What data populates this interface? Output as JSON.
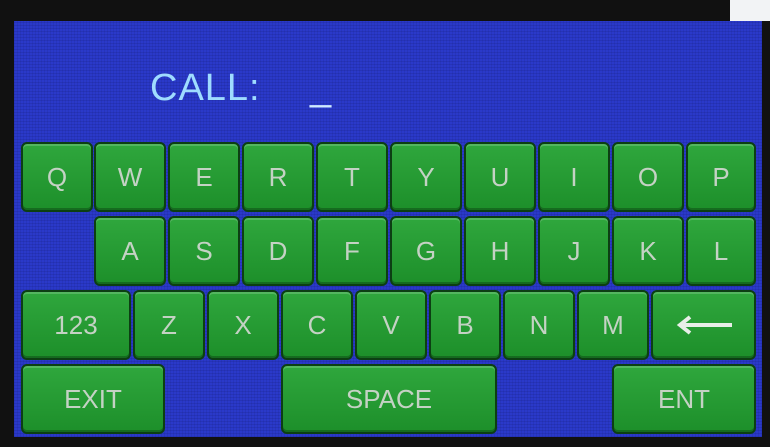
{
  "display": {
    "call_label": "CALL:",
    "call_value": "_"
  },
  "keyboard": {
    "row1": [
      "Q",
      "W",
      "E",
      "R",
      "T",
      "Y",
      "U",
      "I",
      "O",
      "P"
    ],
    "row2": [
      "A",
      "S",
      "D",
      "F",
      "G",
      "H",
      "J",
      "K",
      "L"
    ],
    "row3": [
      "123",
      "Z",
      "X",
      "C",
      "V",
      "B",
      "N",
      "M"
    ],
    "backspace_icon": "left-arrow-icon",
    "exit_label": "EXIT",
    "space_label": "SPACE",
    "enter_label": "ENT"
  },
  "colors": {
    "screen_background": "#2a39c9",
    "key_fill": "#239a33",
    "key_text": "#c4d2c4",
    "call_text": "#9fdcff"
  }
}
